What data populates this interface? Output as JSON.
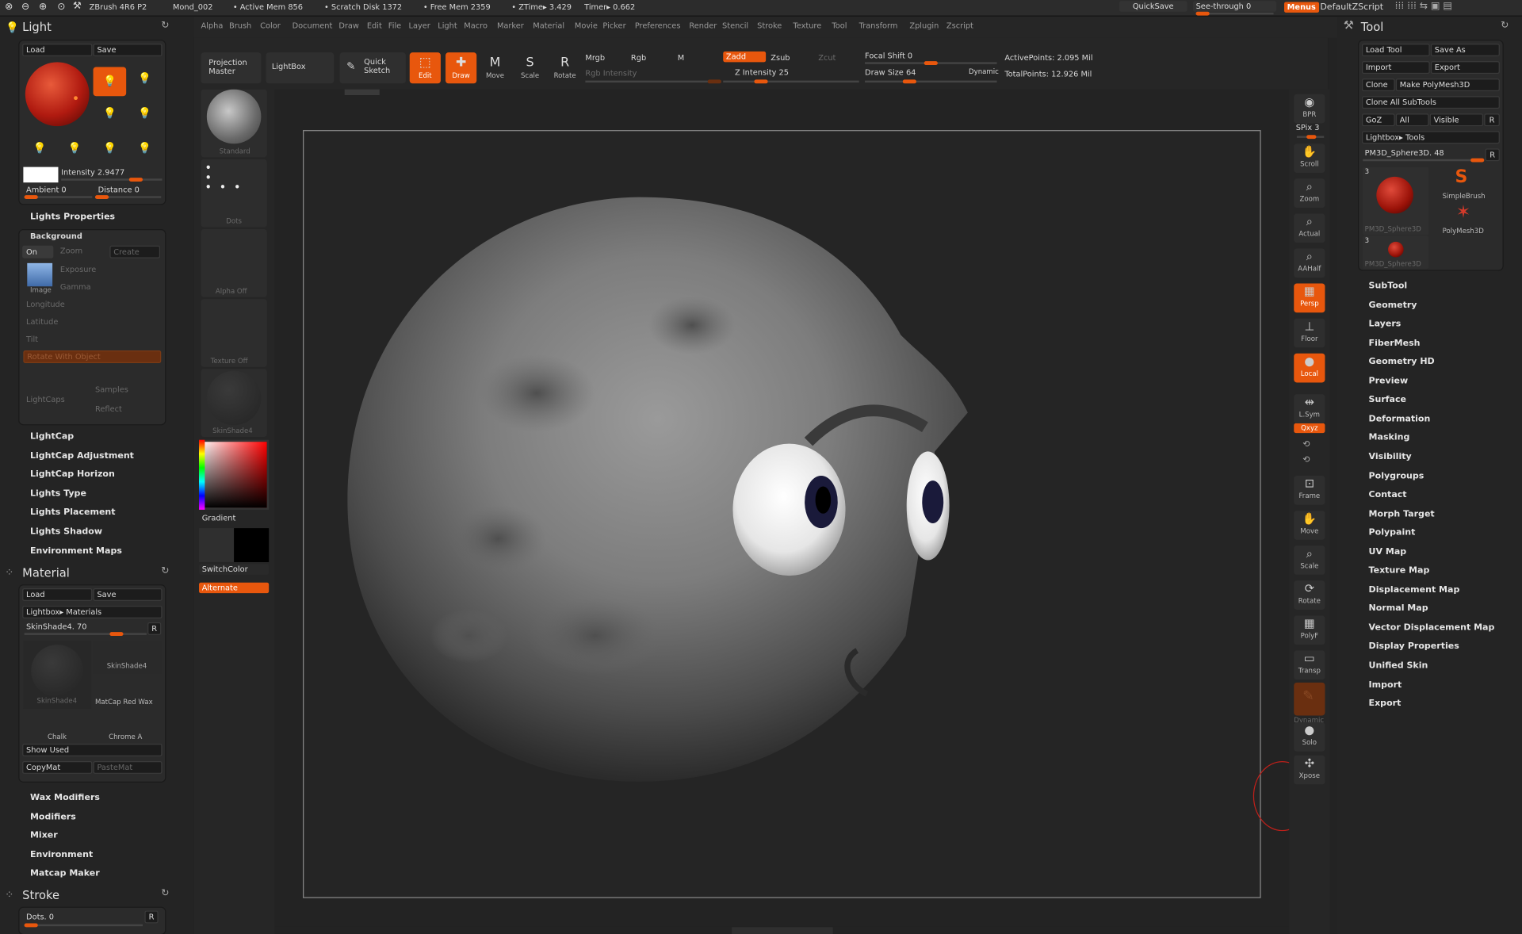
{
  "topbar": {
    "app": "ZBrush 4R6 P2",
    "doc": "Mond_002",
    "active_mem": "• Active Mem 856",
    "scratch": "• Scratch Disk 1372",
    "free_mem": "• Free Mem 2359",
    "ztime": "• ZTime▸ 3.429",
    "timer": "Timer▸ 0.662",
    "quicksave": "QuickSave",
    "see_through": "See-through  0",
    "menus": "Menus",
    "script": "DefaultZScript"
  },
  "menus": [
    "Alpha",
    "Brush",
    "Color",
    "Document",
    "Draw",
    "Edit",
    "File",
    "Layer",
    "Light",
    "Macro",
    "Marker",
    "Material",
    "Movie",
    "Picker",
    "Preferences",
    "Render",
    "Stencil",
    "Stroke",
    "Texture",
    "Tool",
    "Transform",
    "Zplugin",
    "Zscript"
  ],
  "toolbar": {
    "projection": "Projection Master",
    "lightbox": "LightBox",
    "quicksketch": "Quick Sketch",
    "edit": "Edit",
    "draw": "Draw",
    "move": "Move",
    "scale": "Scale",
    "rotate": "Rotate",
    "mrgb": "Mrgb",
    "rgb": "Rgb",
    "m": "M",
    "rgb_intensity": "Rgb Intensity",
    "zadd": "Zadd",
    "zsub": "Zsub",
    "zcut": "Zcut",
    "z_intensity": "Z Intensity 25",
    "focal_shift": "Focal Shift 0",
    "draw_size": "Draw Size 64",
    "dynamic": "Dynamic",
    "active_points": "ActivePoints: 2.095 Mil",
    "total_points": "TotalPoints: 12.926 Mil",
    "z_intensity_value": 25,
    "draw_size_value": 64
  },
  "light": {
    "title": "Light",
    "load": "Load",
    "save": "Save",
    "intensity": "Intensity 2.9477",
    "ambient": "Ambient 0",
    "distance": "Distance 0",
    "properties": "Lights Properties",
    "background": "Background",
    "on": "On",
    "zoom": "Zoom",
    "create": "Create",
    "image": "Image",
    "exposure": "Exposure",
    "gamma": "Gamma",
    "longitude": "Longitude",
    "latitude": "Latitude",
    "tilt": "Tilt",
    "rotate_with_object": "Rotate With Object",
    "lightcaps": "LightCaps",
    "samples": "Samples",
    "reflect": "Reflect",
    "items": [
      "LightCap",
      "LightCap Adjustment",
      "LightCap Horizon",
      "Lights Type",
      "Lights Placement",
      "Lights Shadow",
      "Environment Maps"
    ]
  },
  "material": {
    "title": "Material",
    "load": "Load",
    "save": "Save",
    "lightbox": "Lightbox▸ Materials",
    "current": "SkinShade4. 70",
    "r": "R",
    "thumbs": [
      "SkinShade4",
      "SkinShade4",
      "MatCap Red Wax",
      "Chalk",
      "Chrome A"
    ],
    "show_used": "Show Used",
    "copymat": "CopyMat",
    "pastemat": "PasteMat",
    "items": [
      "Wax Modifiers",
      "Modifiers",
      "Mixer",
      "Environment",
      "Matcap Maker"
    ]
  },
  "stroke": {
    "title": "Stroke",
    "dots": "Dots. 0",
    "r": "R"
  },
  "shelf": {
    "standard": "Standard",
    "dots": "Dots",
    "alpha_off": "Alpha Off",
    "texture_off": "Texture Off",
    "skinshade": "SkinShade4",
    "gradient": "Gradient",
    "switchcolor": "SwitchColor",
    "alternate": "Alternate"
  },
  "rightshelf": [
    {
      "icon": "bpr-icon",
      "g": "◉",
      "label": "BPR"
    },
    {
      "icon": "scroll-icon",
      "g": "✋",
      "label": "Scroll"
    },
    {
      "icon": "zoom-icon",
      "g": "⌕",
      "label": "Zoom"
    },
    {
      "icon": "actual-icon",
      "g": "⌕",
      "label": "Actual"
    },
    {
      "icon": "aahalf-icon",
      "g": "⌕",
      "label": "AAHalf"
    },
    {
      "icon": "persp-icon",
      "g": "▦",
      "label": "Persp"
    },
    {
      "icon": "floor-icon",
      "g": "⊥",
      "label": "Floor"
    },
    {
      "icon": "local-icon",
      "g": "●",
      "label": "Local"
    },
    {
      "icon": "lsym-icon",
      "g": "⇹",
      "label": "L.Sym"
    },
    {
      "icon": "frame-icon",
      "g": "⊡",
      "label": "Frame"
    },
    {
      "icon": "move-icon",
      "g": "✋",
      "label": "Move"
    },
    {
      "icon": "scale-icon",
      "g": "⌕",
      "label": "Scale"
    },
    {
      "icon": "rotate-icon",
      "g": "⟳",
      "label": "Rotate"
    },
    {
      "icon": "polyf-icon",
      "g": "▦",
      "label": "PolyF"
    },
    {
      "icon": "transp-icon",
      "g": "▭",
      "label": "Transp"
    },
    {
      "icon": "solo-icon",
      "g": "●",
      "label": "Solo"
    },
    {
      "icon": "xpose-icon",
      "g": "✣",
      "label": "Xpose"
    }
  ],
  "spix": "SPix 3",
  "xyz": "Qxyz",
  "dynamic_label": "Dynamic",
  "tool": {
    "title": "Tool",
    "load": "Load Tool",
    "saveas": "Save As",
    "import": "Import",
    "export": "Export",
    "clone": "Clone",
    "make_poly": "Make PolyMesh3D",
    "clone_all": "Clone All SubTools",
    "goz": "GoZ",
    "all": "All",
    "visible": "Visible",
    "r": "R",
    "lightbox": "Lightbox▸ Tools",
    "current": "PM3D_Sphere3D. 48",
    "thumb1": "PM3D_Sphere3D",
    "thumb2": "SimpleBrush",
    "thumb3": "PolyMesh3D",
    "thumb4": "PM3D_Sphere3D",
    "count1": "3",
    "count2": "3",
    "items": [
      "SubTool",
      "Geometry",
      "Layers",
      "FiberMesh",
      "Geometry HD",
      "Preview",
      "Surface",
      "Deformation",
      "Masking",
      "Visibility",
      "Polygroups",
      "Contact",
      "Morph Target",
      "Polypaint",
      "UV Map",
      "Texture Map",
      "Displacement Map",
      "Normal Map",
      "Vector Displacement Map",
      "Display Properties",
      "Unified Skin",
      "Import",
      "Export"
    ]
  },
  "colors": {
    "accent": "#e8570d",
    "bg": "#232323"
  }
}
